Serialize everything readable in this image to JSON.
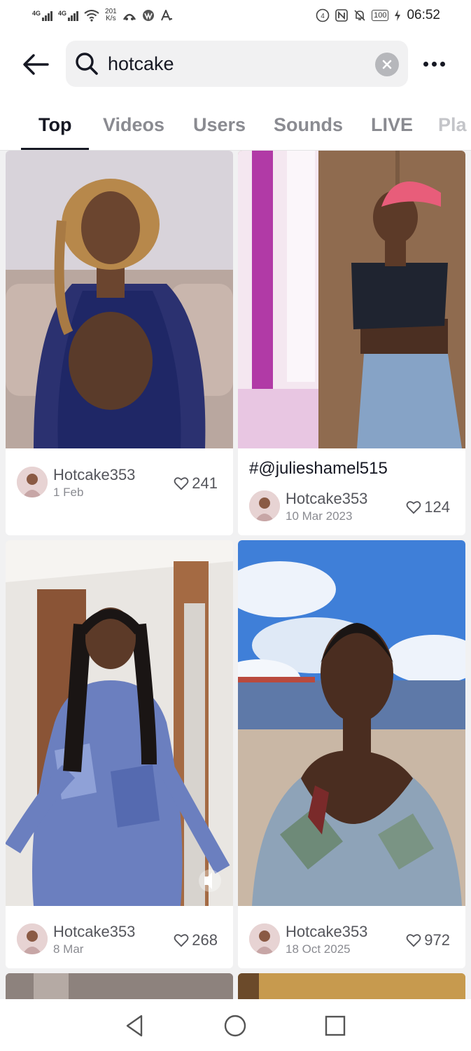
{
  "status_bar": {
    "signal_1": "4G",
    "signal_2": "4G",
    "speed_value": "201",
    "speed_unit": "K/s",
    "battery": "100",
    "time": "06:52",
    "icons": [
      "wifi-icon",
      "app-icon",
      "vpn-icon",
      "font-icon",
      "nfc-icon",
      "mute-icon",
      "charging-icon"
    ]
  },
  "search": {
    "query": "hotcake",
    "back_icon": "arrow-left-icon",
    "search_icon": "search-icon",
    "clear_icon": "close-icon",
    "more_icon": "more-icon"
  },
  "tabs": [
    "Top",
    "Videos",
    "Users",
    "Sounds",
    "LIVE",
    "Pla"
  ],
  "active_tab": "Top",
  "results": [
    {
      "title": "",
      "user": "Hotcake353",
      "date": "1 Feb",
      "likes": "241"
    },
    {
      "title": "#@julieshamel515",
      "user": "Hotcake353",
      "date": "10 Mar 2023",
      "likes": "124"
    },
    {
      "title": "",
      "user": "Hotcake353",
      "date": "8 Mar",
      "likes": "268"
    },
    {
      "title": "",
      "user": "Hotcake353",
      "date": "18 Oct 2025",
      "likes": "972"
    }
  ],
  "nav": [
    "back-icon",
    "home-icon",
    "recents-icon"
  ]
}
